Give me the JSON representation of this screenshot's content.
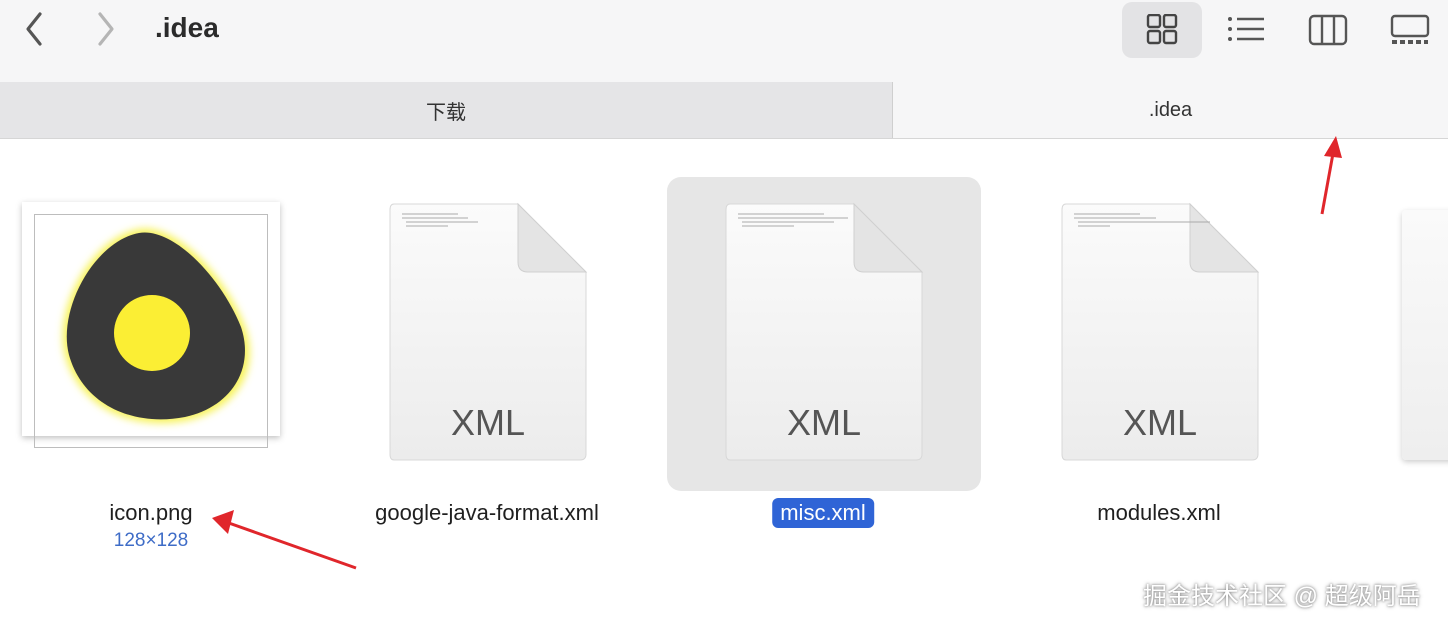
{
  "toolbar": {
    "title": ".idea",
    "back_icon": "chevron-left-icon",
    "forward_icon": "chevron-right-icon",
    "views": [
      "grid-view-icon",
      "list-view-icon",
      "column-view-icon",
      "gallery-view-icon"
    ]
  },
  "tabs": [
    {
      "label": "下载"
    },
    {
      "label": ".idea"
    }
  ],
  "files": [
    {
      "name": "icon.png",
      "subtitle": "128×128"
    },
    {
      "name": "google-java-format.xml",
      "kind": "XML"
    },
    {
      "name": "misc.xml",
      "kind": "XML"
    },
    {
      "name": "modules.xml",
      "kind": "XML"
    }
  ],
  "watermark": "掘金技术社区 @ 超级阿岳",
  "colors": {
    "accent": "#2f64d6",
    "arrow": "#e0262b"
  }
}
